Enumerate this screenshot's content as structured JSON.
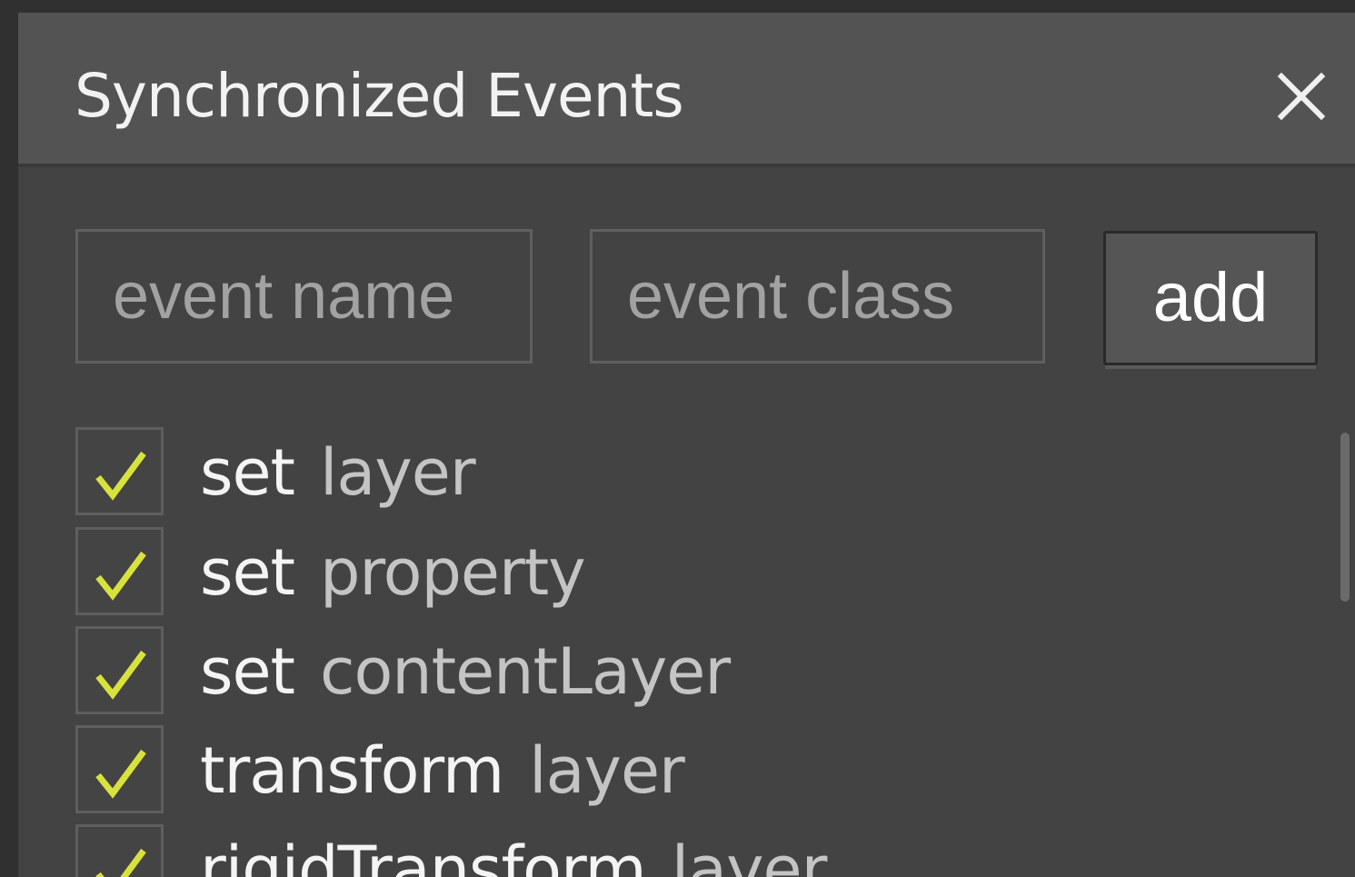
{
  "dialog": {
    "title": "Synchronized Events",
    "close_icon": "close-icon"
  },
  "form": {
    "event_name_placeholder": "event name",
    "event_class_placeholder": "event class",
    "add_label": "add"
  },
  "events": [
    {
      "name": "set",
      "class": "layer",
      "checked": true
    },
    {
      "name": "set",
      "class": "property",
      "checked": true
    },
    {
      "name": "set",
      "class": "contentLayer",
      "checked": true
    },
    {
      "name": "transform",
      "class": "layer",
      "checked": true
    },
    {
      "name": "rigidTransform",
      "class": "layer",
      "checked": true
    }
  ],
  "colors": {
    "check": "#d8e23c",
    "panel": "#434343",
    "titlebar": "#535353"
  }
}
